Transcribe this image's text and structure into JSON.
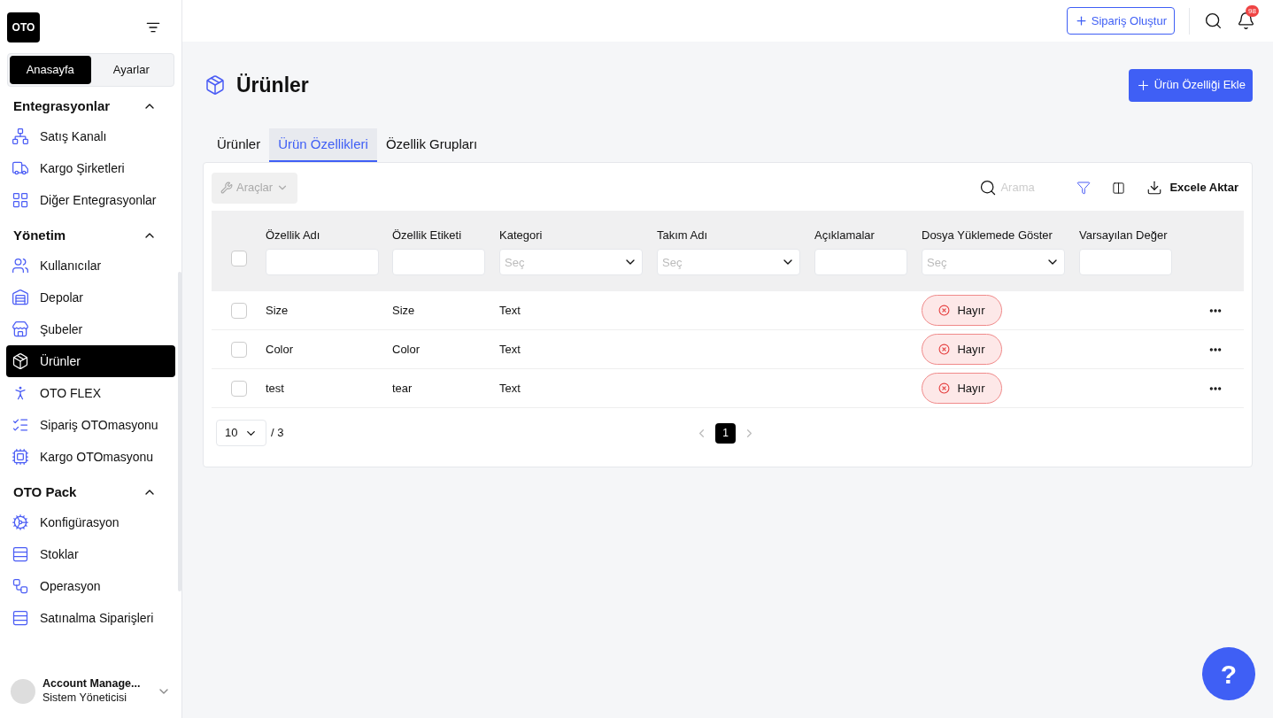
{
  "logo": "OTO",
  "sidebar_tabs": [
    {
      "label": "Anasayfa",
      "selected": true
    },
    {
      "label": "Ayarlar",
      "selected": false
    }
  ],
  "sidebar_sections": [
    {
      "title": "Entegrasyonlar",
      "expanded": true,
      "items": [
        {
          "label": "Satış Kanalı",
          "selected": false
        },
        {
          "label": "Kargo Şirketleri",
          "selected": false
        },
        {
          "label": "Diğer Entegrasyonlar",
          "selected": false
        }
      ]
    },
    {
      "title": "Yönetim",
      "expanded": true,
      "items": [
        {
          "label": "Kullanıcılar",
          "selected": false
        },
        {
          "label": "Depolar",
          "selected": false
        },
        {
          "label": "Şubeler",
          "selected": false
        },
        {
          "label": "Ürünler",
          "selected": true
        },
        {
          "label": "OTO FLEX",
          "selected": false
        },
        {
          "label": "Sipariş OTOmasyonu",
          "selected": false
        },
        {
          "label": "Kargo OTOmasyonu",
          "selected": false
        }
      ]
    },
    {
      "title": "OTO Pack",
      "expanded": true,
      "items": [
        {
          "label": "Konfigürasyon",
          "selected": false
        },
        {
          "label": "Stoklar",
          "selected": false
        },
        {
          "label": "Operasyon",
          "selected": false
        },
        {
          "label": "Satınalma Siparişleri",
          "selected": false
        }
      ]
    }
  ],
  "account": {
    "name": "Account Manage...",
    "role": "Sistem Yöneticisi"
  },
  "topbar": {
    "create_button": "Sipariş Oluştur",
    "notification_count": "98"
  },
  "page": {
    "title": "Ürünler",
    "add_button": "Ürün Özelliği Ekle"
  },
  "tabs": [
    {
      "label": "Ürünler",
      "selected": false
    },
    {
      "label": "Ürün Özellikleri",
      "selected": true
    },
    {
      "label": "Özellik Grupları",
      "selected": false
    }
  ],
  "toolbar": {
    "tools_button": "Araçlar",
    "tools_disabled": true,
    "search_placeholder": "Arama",
    "export_button": "Excele Aktar"
  },
  "table": {
    "all_selected": false,
    "columns": [
      {
        "label": "Özellik Adı",
        "kind": "input"
      },
      {
        "label": "Özellik Etiketi",
        "kind": "input"
      },
      {
        "label": "Kategori",
        "kind": "select",
        "placeholder": "Seç"
      },
      {
        "label": "Takım Adı",
        "kind": "select",
        "placeholder": "Seç"
      },
      {
        "label": "Açıklamalar",
        "kind": "input"
      },
      {
        "label": "Dosya Yüklemede Göster",
        "kind": "select",
        "placeholder": "Seç"
      },
      {
        "label": "Varsayılan Değer",
        "kind": "input"
      }
    ],
    "rows": [
      {
        "selected": false,
        "name": "Size",
        "label": "Size",
        "category": "Text",
        "show_in_upload": "Hayır"
      },
      {
        "selected": false,
        "name": "Color",
        "label": "Color",
        "category": "Text",
        "show_in_upload": "Hayır"
      },
      {
        "selected": false,
        "name": "test",
        "label": "tear",
        "category": "Text",
        "show_in_upload": "Hayır"
      }
    ]
  },
  "pagination": {
    "page_size": "10",
    "total": "/ 3",
    "pages": [
      {
        "label": "1",
        "selected": true
      }
    ]
  },
  "help_button": "?"
}
